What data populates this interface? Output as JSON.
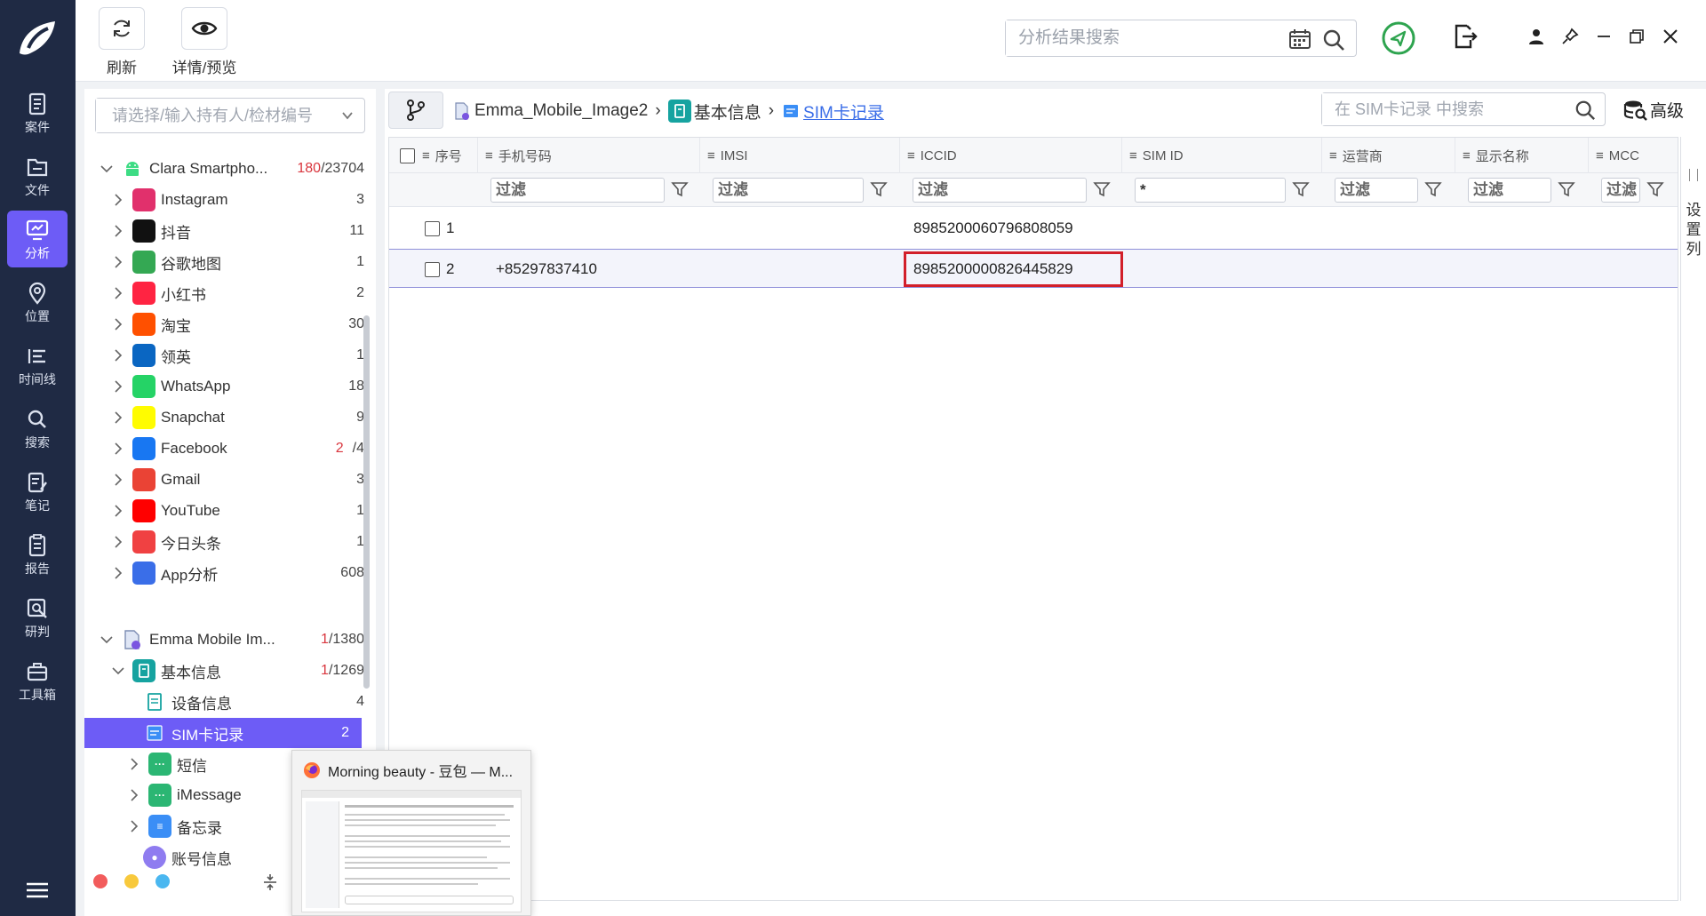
{
  "nav": {
    "items": [
      {
        "label": "案件",
        "icon": "case-icon"
      },
      {
        "label": "文件",
        "icon": "folder-icon"
      },
      {
        "label": "分析",
        "icon": "analysis-icon",
        "active": true
      },
      {
        "label": "位置",
        "icon": "location-icon"
      },
      {
        "label": "时间线",
        "icon": "timeline-icon"
      },
      {
        "label": "搜索",
        "icon": "search-icon"
      },
      {
        "label": "笔记",
        "icon": "note-icon"
      },
      {
        "label": "报告",
        "icon": "report-icon"
      },
      {
        "label": "研判",
        "icon": "judge-icon"
      },
      {
        "label": "工具箱",
        "icon": "toolbox-icon"
      }
    ]
  },
  "toolbar": {
    "refresh_label": "刷新",
    "detail_label": "详情/预览",
    "search_placeholder": "分析结果搜索"
  },
  "tree": {
    "holder_placeholder": "请选择/输入持有人/检材编号",
    "device1": {
      "label": "Clara Smartpho...",
      "count_red": "180",
      "count_total": "/23704"
    },
    "apps": [
      {
        "label": "Instagram",
        "count": "3",
        "icon": "instagram-icon",
        "color": "#e1306c"
      },
      {
        "label": "抖音",
        "count": "11",
        "icon": "douyin-icon",
        "color": "#111111"
      },
      {
        "label": "谷歌地图",
        "count": "1",
        "icon": "google-maps-icon",
        "color": "#34a853"
      },
      {
        "label": "小红书",
        "count": "2",
        "icon": "xiaohongshu-icon",
        "color": "#ff2442"
      },
      {
        "label": "淘宝",
        "count": "30",
        "icon": "taobao-icon",
        "color": "#ff5000"
      },
      {
        "label": "领英",
        "count": "1",
        "icon": "linkedin-icon",
        "color": "#0a66c2"
      },
      {
        "label": "WhatsApp",
        "count": "18",
        "icon": "whatsapp-icon",
        "color": "#25d366"
      },
      {
        "label": "Snapchat",
        "count": "9",
        "icon": "snapchat-icon",
        "color": "#fffc00"
      },
      {
        "label": "Facebook",
        "count_red": "2",
        "count": "/4",
        "icon": "facebook-icon",
        "color": "#1877f2"
      },
      {
        "label": "Gmail",
        "count": "3",
        "icon": "gmail-icon",
        "color": "#ea4335"
      },
      {
        "label": "YouTube",
        "count": "1",
        "icon": "youtube-icon",
        "color": "#ff0000"
      },
      {
        "label": "今日头条",
        "count": "1",
        "icon": "toutiao-icon",
        "color": "#f04142"
      },
      {
        "label": "App分析",
        "count": "608",
        "icon": "app-grid-icon",
        "color": "#3a6ee8"
      }
    ],
    "device2": {
      "label": "Emma Mobile Im...",
      "count_red": "1",
      "count_total": "/1380"
    },
    "basic_info": {
      "label": "基本信息",
      "count_red": "1",
      "count_total": "/1269"
    },
    "basic_children": [
      {
        "label": "设备信息",
        "count": "4",
        "icon": "device-info-icon"
      },
      {
        "label": "SIM卡记录",
        "count": "2",
        "icon": "sim-card-icon",
        "selected": true
      }
    ],
    "more": [
      {
        "label": "短信",
        "icon": "sms-icon"
      },
      {
        "label": "iMessage",
        "icon": "imessage-icon"
      },
      {
        "label": "备忘录",
        "icon": "memo-icon"
      },
      {
        "label": "账号信息",
        "icon": "account-icon"
      }
    ]
  },
  "breadcrumb": {
    "device": "Emma_Mobile_Image2",
    "category": "基本信息",
    "current": "SIM卡记录"
  },
  "module_search": {
    "placeholder": "在 SIM卡记录 中搜索"
  },
  "advanced_label": "高级",
  "settings_label": "设置列",
  "table": {
    "columns": [
      "序号",
      "手机号码",
      "IMSI",
      "ICCID",
      "SIM ID",
      "运营商",
      "显示名称",
      "MCC"
    ],
    "filter_placeholder": "过滤",
    "simid_filter_value": "*",
    "rows": [
      {
        "no": "1",
        "phone": "",
        "imsi": "",
        "iccid": "8985200060796808059",
        "simid": "",
        "carrier": "",
        "display": "",
        "mcc": ""
      },
      {
        "no": "2",
        "phone": "+85297837410",
        "imsi": "",
        "iccid": "8985200000826445829",
        "simid": "",
        "carrier": "",
        "display": "",
        "mcc": ""
      }
    ]
  },
  "taskbar_preview": {
    "title": "Morning beauty - 豆包 — M..."
  },
  "colors": {
    "nav_bg": "#1f2a44",
    "accent": "#6d5cf6",
    "highlight": "#d21f2a",
    "link": "#3a6ee8"
  }
}
